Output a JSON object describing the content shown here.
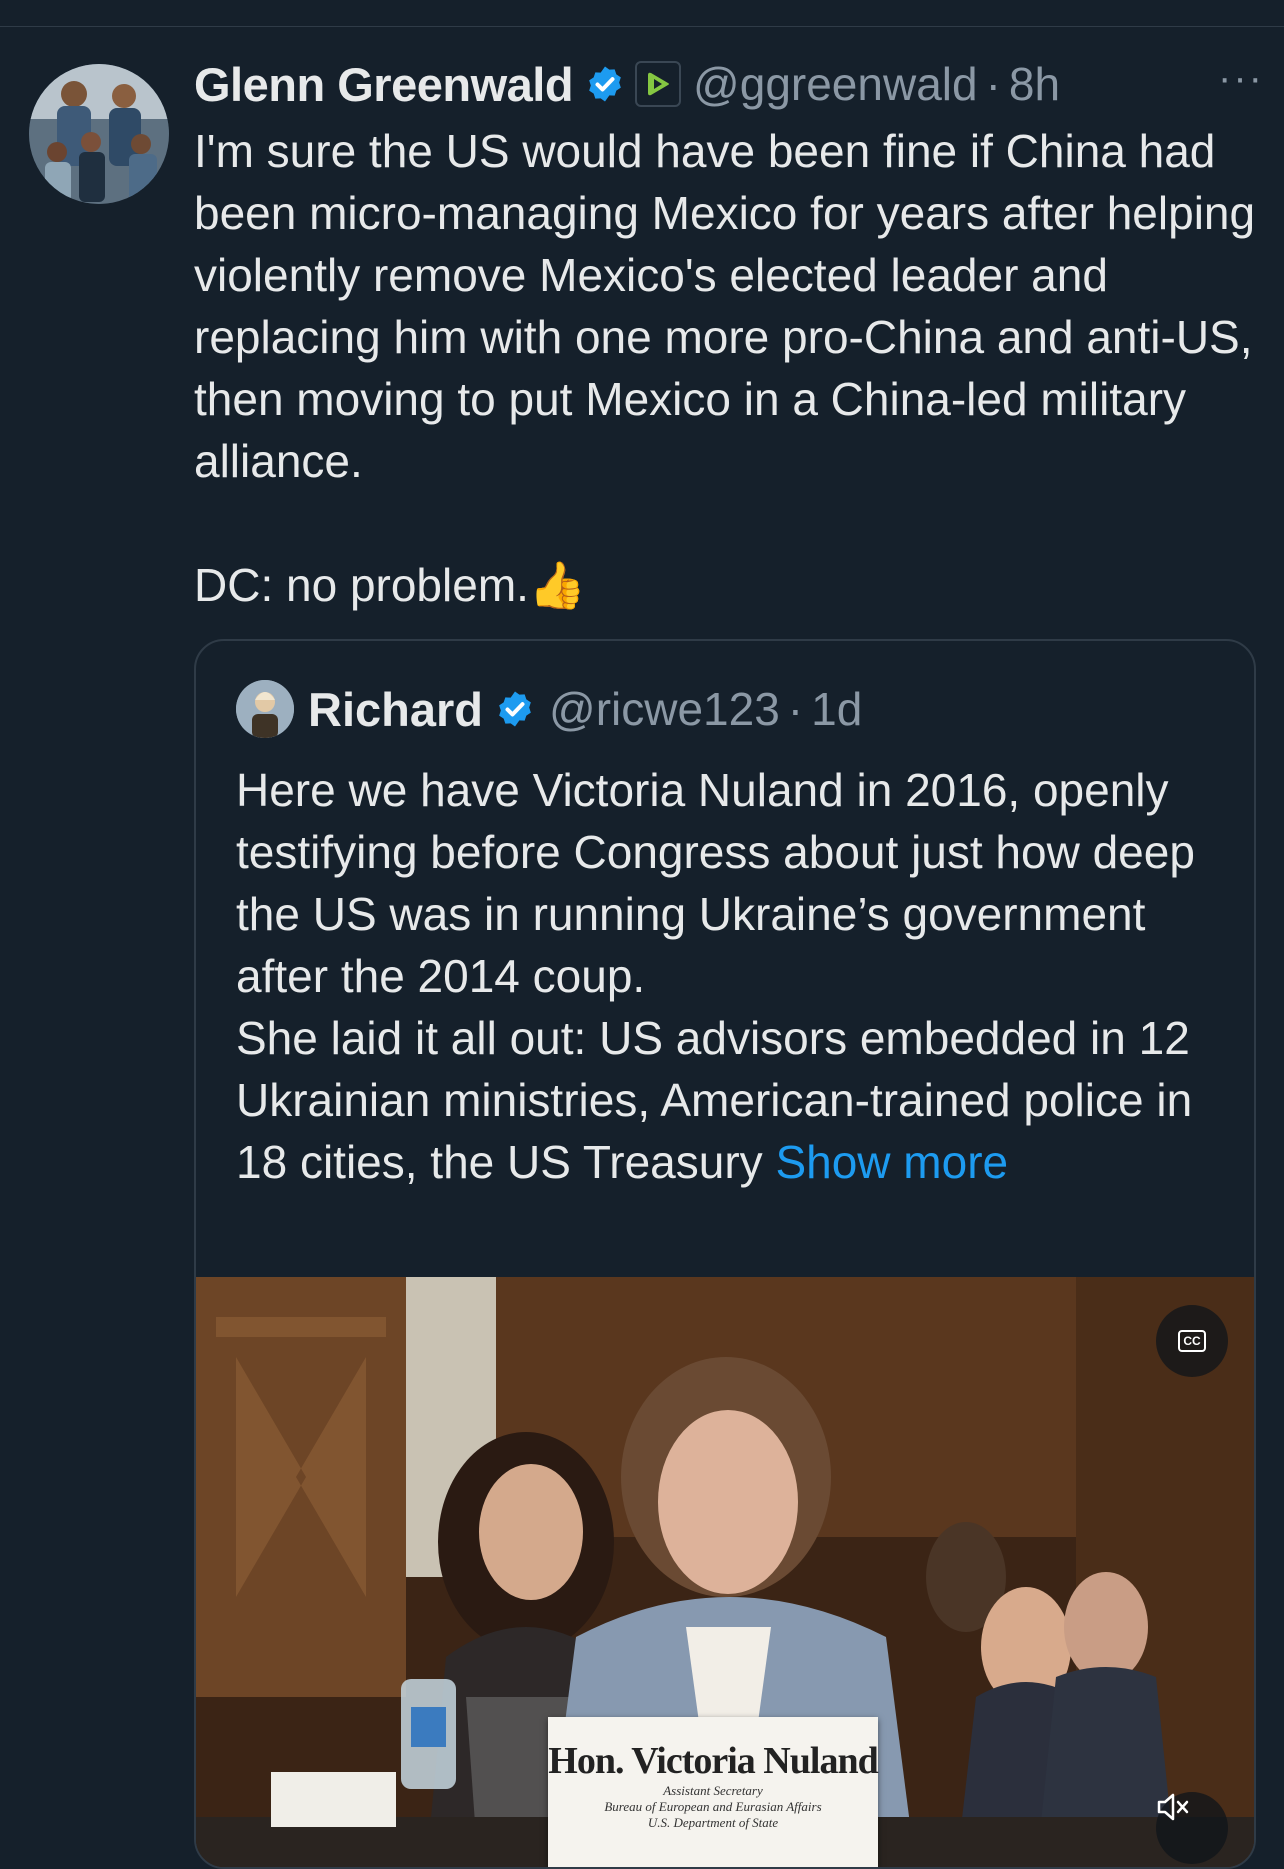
{
  "tweet": {
    "author_name": "Glenn Greenwald",
    "handle": "@ggreenwald",
    "separator": "·",
    "time": "8h",
    "more_icon": "···",
    "paragraphs": [
      "I'm sure the US would have been fine if China had been micro-managing Mexico for years after helping violently remove Mexico's elected leader and replacing him with one more pro-China and anti-US, then moving to put Mexico in a China-led military alliance.",
      "DC: no problem.👍"
    ]
  },
  "quoted": {
    "author_name": "Richard",
    "handle": "@ricwe123",
    "separator": "·",
    "time": "1d",
    "text_lines": [
      "Here we have Victoria Nuland in 2016, openly testifying before Congress about just how deep the US was in running Ukraine’s government after the 2014 coup.",
      "She laid it all out: US advisors embedded in 12 Ukrainian ministries, American-trained police in 18 cities, the US Treasury"
    ],
    "show_more": "Show more",
    "media": {
      "cc_label": "CC",
      "nameplate": {
        "name": "Hon. Victoria Nuland",
        "title": "Assistant Secretary",
        "bureau": "Bureau of European and Eurasian Affairs",
        "department": "U.S. Department of State"
      }
    }
  },
  "colors": {
    "background": "#15202b",
    "text": "#e7e9ea",
    "secondary": "#8b98a5",
    "link": "#1d9bf0",
    "verified": "#1d9bf0"
  }
}
